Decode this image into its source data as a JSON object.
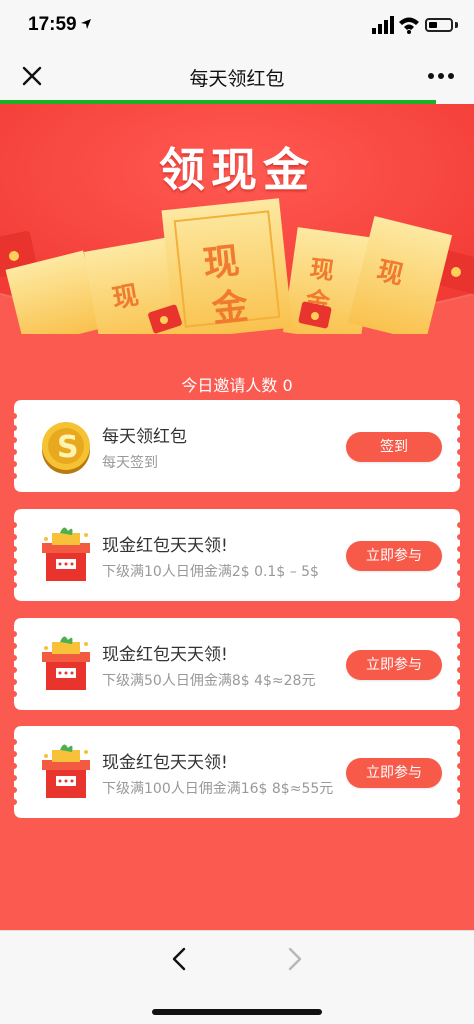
{
  "status_bar": {
    "time": "17:59",
    "icons": [
      "location-arrow-icon",
      "signal-icon",
      "wifi-icon",
      "battery-icon"
    ]
  },
  "nav": {
    "title": "每天领红包",
    "close_icon": "close-icon",
    "more_icon": "more-icon"
  },
  "page": {
    "hero_title": "领现金",
    "ticket_chars": [
      "现",
      "金"
    ],
    "invite_label": "今日邀请人数",
    "invite_count": "0"
  },
  "cards": [
    {
      "icon": "gold-coin-icon",
      "title": "每天领红包",
      "subtitle": "每天签到",
      "button": "签到"
    },
    {
      "icon": "gift-box-icon",
      "title": "现金红包天天领!",
      "subtitle": "下级满10人日佣金满2$ 0.1$ – 5$",
      "button": "立即参与"
    },
    {
      "icon": "gift-box-icon",
      "title": "现金红包天天领!",
      "subtitle": "下级满50人日佣金满8$ 4$≈28元",
      "button": "立即参与"
    },
    {
      "icon": "gift-box-icon",
      "title": "现金红包天天领!",
      "subtitle": "下级满100人日佣金满16$ 8$≈55元",
      "button": "立即参与"
    }
  ],
  "toolbar": {
    "back_icon": "chevron-left-icon",
    "forward_icon": "chevron-right-icon"
  },
  "colors": {
    "page_bg": "#fa5a50",
    "accent_button": "#f75a48",
    "progress": "#1db027"
  }
}
